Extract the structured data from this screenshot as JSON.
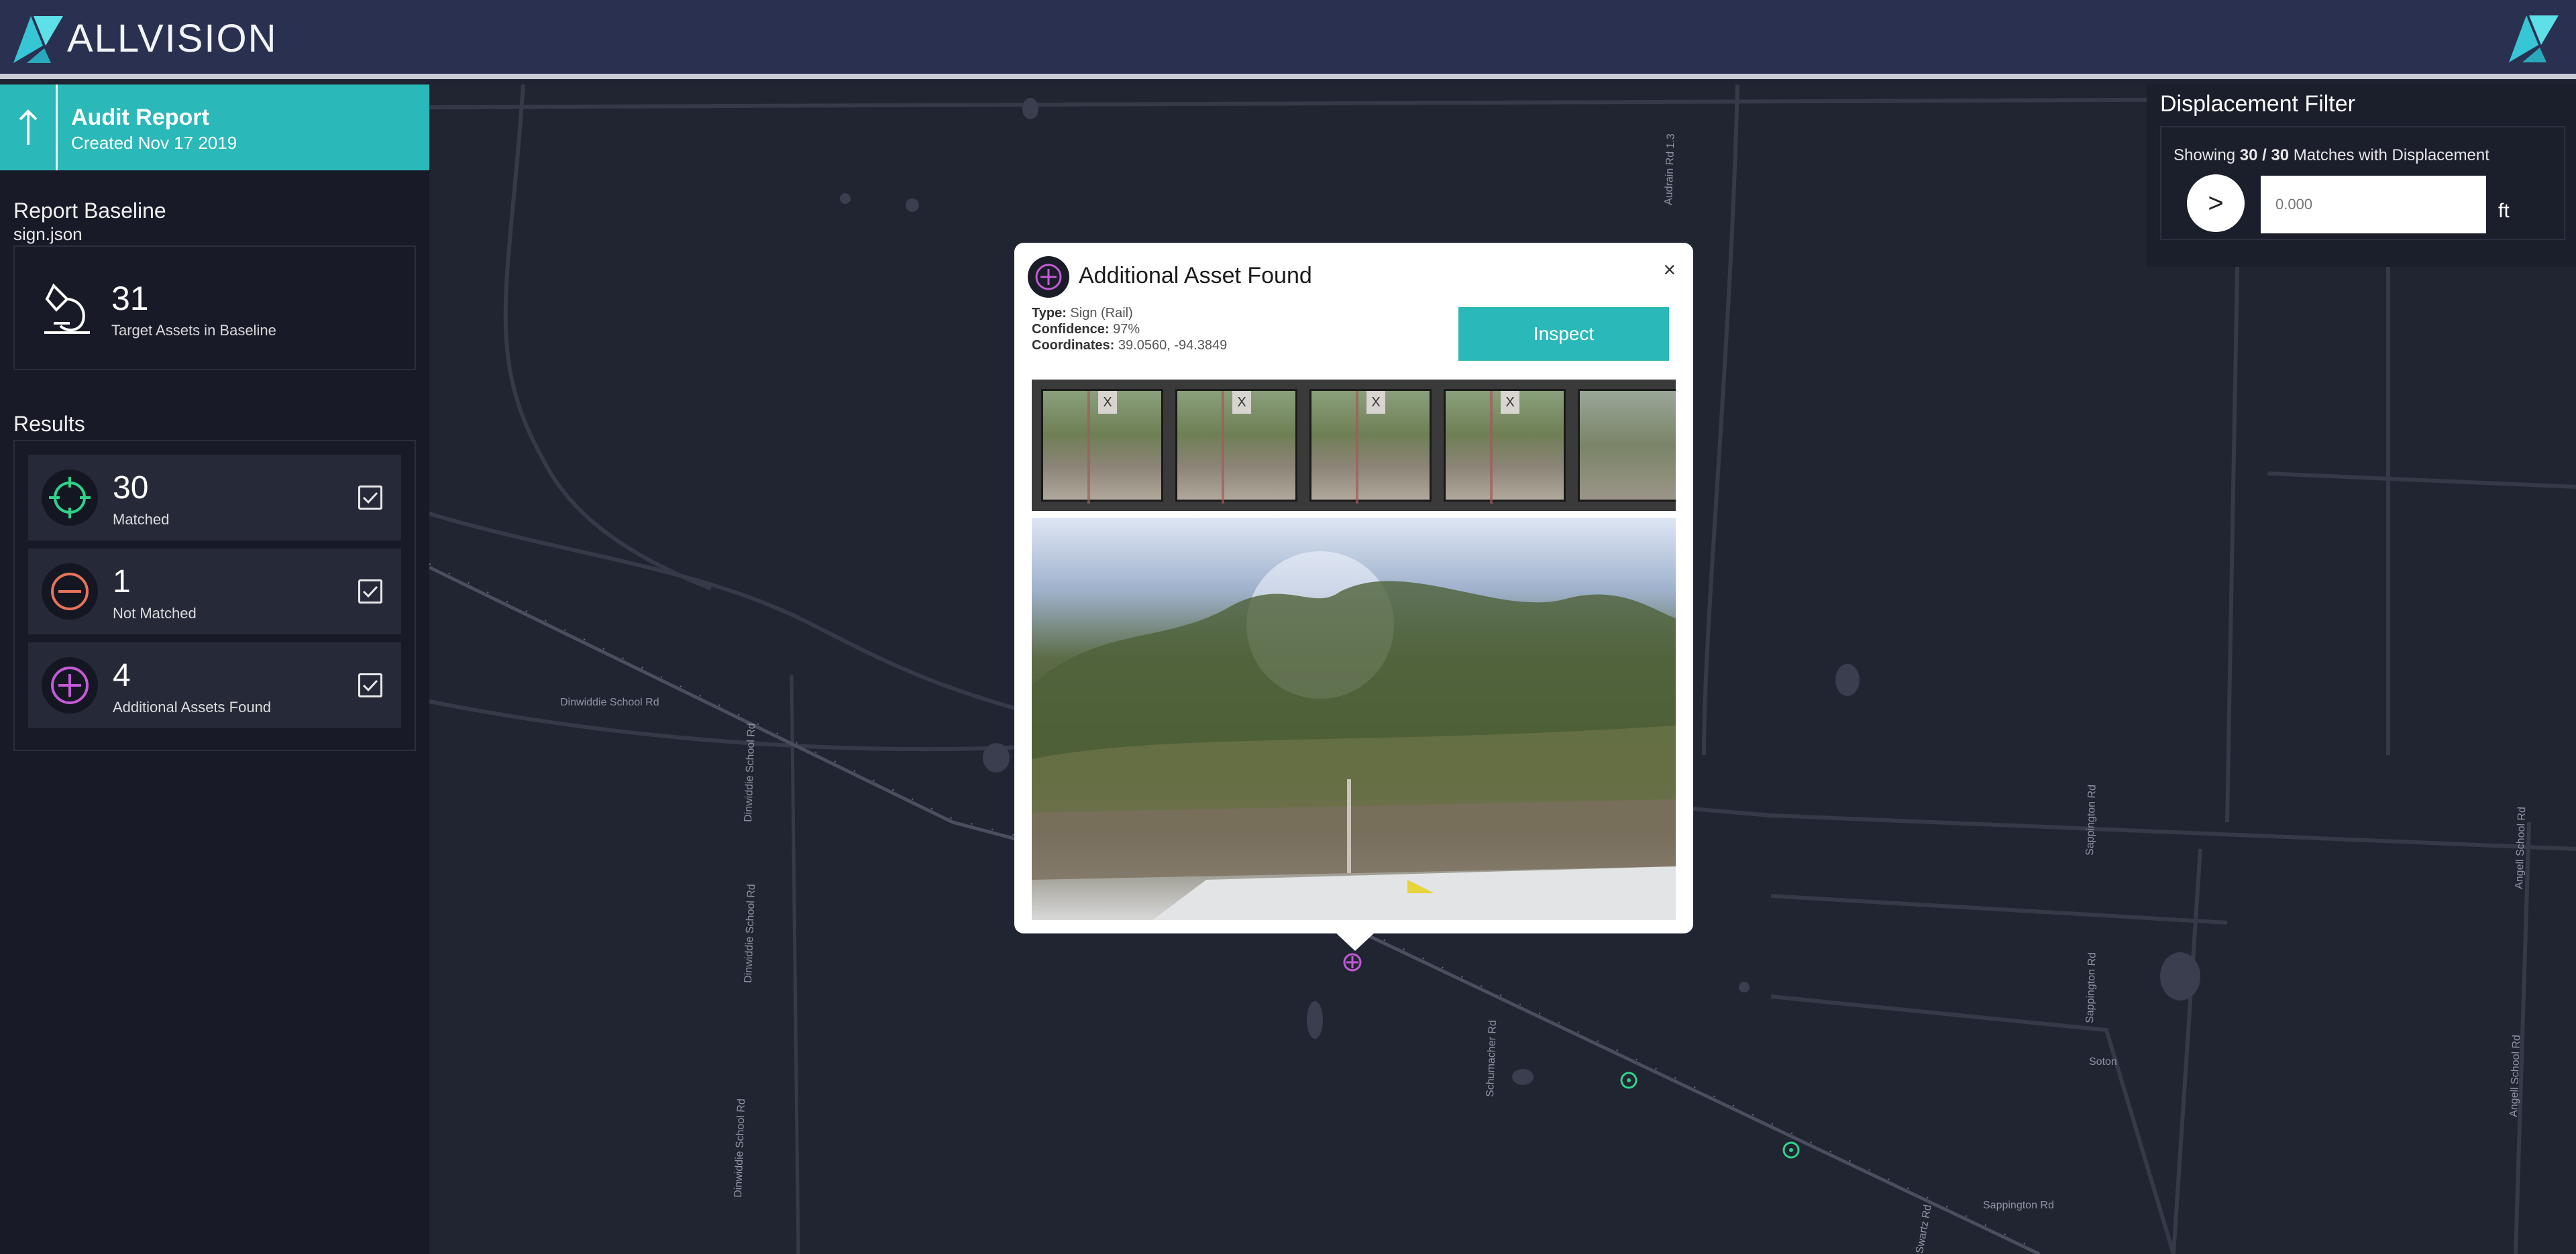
{
  "header": {
    "brand": "ALLVISION",
    "accent_color": "#2bb8b8",
    "logo_icon": "allvision-logo-icon"
  },
  "audit": {
    "title": "Audit Report",
    "created": "Created Nov 17 2019",
    "back_icon": "arrow-up-icon"
  },
  "baseline": {
    "section_title": "Report Baseline",
    "file": "sign.json",
    "count": "31",
    "label": "Target Assets in Baseline"
  },
  "results": {
    "section_title": "Results",
    "items": [
      {
        "count": "30",
        "label": "Matched",
        "icon": "crosshair-icon",
        "color": "#2ed28a",
        "checked": true
      },
      {
        "count": "1",
        "label": "Not Matched",
        "icon": "minus-circle-icon",
        "color": "#e8735a",
        "checked": true
      },
      {
        "count": "4",
        "label": "Additional Assets Found",
        "icon": "plus-circle-icon",
        "color": "#c25ad6",
        "checked": true
      }
    ]
  },
  "displacement": {
    "title": "Displacement Filter",
    "showing_prefix": "Showing ",
    "showing_count": "30 / 30",
    "showing_suffix": " Matches with Displacement",
    "operator": ">",
    "placeholder": "0.000",
    "unit": "ft"
  },
  "popup": {
    "title": "Additional Asset Found",
    "type_label": "Type:",
    "type_value": "Sign (Rail)",
    "confidence_label": "Confidence:",
    "confidence_value": "97%",
    "coordinates_label": "Coordinates:",
    "coordinates_value": "39.0560, -94.3849",
    "inspect_label": "Inspect",
    "close": "×",
    "thumb_sign_text": "X"
  },
  "map": {
    "roads": [
      "Dinwiddie School Rd",
      "Dinwiddie School Rd",
      "Dinwiddie School Rd",
      "Dinwiddie School Rd",
      "Schumacher Rd",
      "Sappington Rd",
      "Sappington Rd",
      "Sappington Rd",
      "Angell School Rd",
      "Angell School Rd",
      "Audrain Rd 1.3",
      "Soton",
      "Swartz Rd"
    ],
    "markers": [
      {
        "kind": "additional",
        "color": "#c25ad6"
      },
      {
        "kind": "matched",
        "color": "#2ed28a"
      },
      {
        "kind": "matched",
        "color": "#2ed28a"
      }
    ]
  }
}
